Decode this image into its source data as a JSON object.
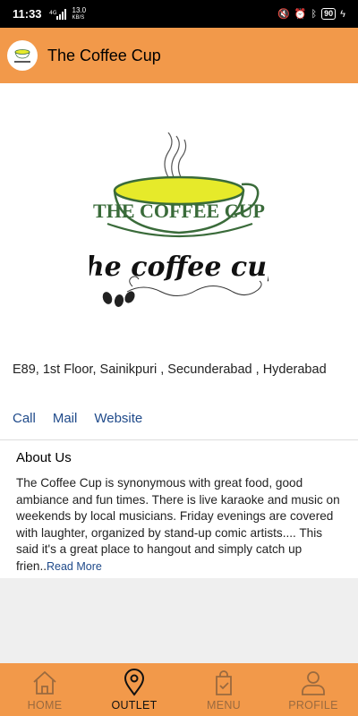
{
  "status_bar": {
    "time": "11:33",
    "network": "4G",
    "speed_value": "13.0",
    "speed_unit": "KB/S",
    "battery": "90"
  },
  "header": {
    "title": "The Coffee Cup",
    "avatar_icon": "coffee-cup-logo"
  },
  "outlet": {
    "address": "E89, 1st Floor,  Sainikpuri ,  Secunderabad , Hyderabad",
    "links": {
      "call": "Call",
      "mail": "Mail",
      "website": "Website"
    },
    "logo_arc_text": "THE COFFEE CUP",
    "logo_script_text": "the coffee cup"
  },
  "about": {
    "title": "About Us",
    "text": "The Coffee Cup is synonymous with great food, good ambiance and fun times. There is live karaoke and music on weekends by local musicians. Friday evenings are covered with laughter, organized by stand-up comic artists.... This said it's a great place to hangout and simply catch up frien..",
    "read_more": "Read More"
  },
  "bottom_nav": {
    "home": "HOME",
    "outlet": "OUTLET",
    "menu": "MENU",
    "profile": "PROFILE",
    "active": "outlet"
  },
  "colors": {
    "accent": "#f2994a",
    "link": "#1f4a8a",
    "logo_green": "#3a6b3a",
    "logo_yellow": "#e6ea2a"
  }
}
